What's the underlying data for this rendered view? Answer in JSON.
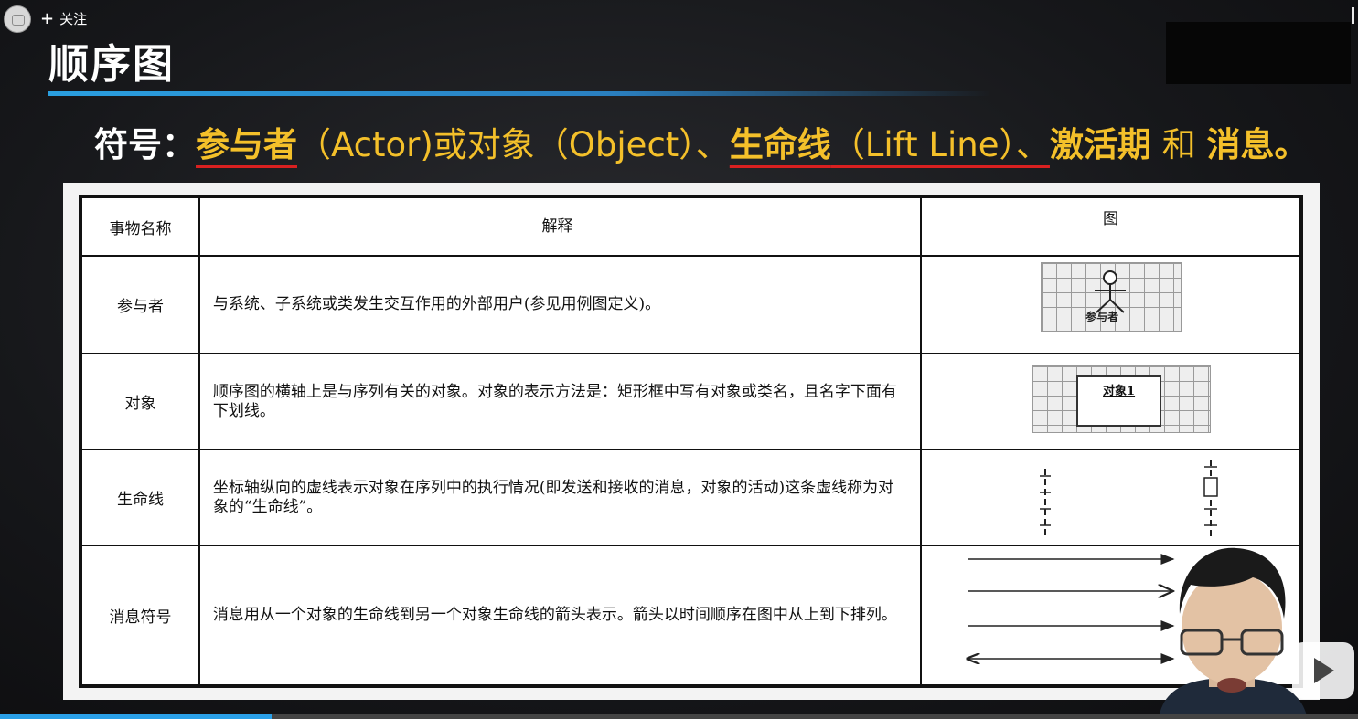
{
  "follow": {
    "label": "关注"
  },
  "slide": {
    "title": "顺序图",
    "subtitle_parts": [
      "符号：",
      "参与者",
      "（Actor)或对象（Object）、",
      "生命线",
      "（Lift Line）、",
      "激活期",
      " 和 ",
      "消息",
      "。"
    ]
  },
  "table": {
    "headers": [
      "事物名称",
      "解释",
      "图"
    ],
    "rows": [
      {
        "name": "参与者",
        "desc": "与系统、子系统或类发生交互作用的外部用户(参见用例图定义)。"
      },
      {
        "name": "对象",
        "desc": "顺序图的横轴上是与序列有关的对象。对象的表示方法是：矩形框中写有对象或类名，且名字下面有下划线。"
      },
      {
        "name": "生命线",
        "desc": "坐标轴纵向的虚线表示对象在序列中的执行情况(即发送和接收的消息，对象的活动)这条虚线称为对象的“生命线”。"
      },
      {
        "name": "消息符号",
        "desc": "消息用从一个对象的生命线到另一个对象生命线的箭头表示。箭头以时间顺序在图中从上到下排列。"
      }
    ],
    "figure_labels": {
      "actor": "参与者",
      "object": "对象1"
    }
  },
  "video": {
    "progress_fraction": 0.2
  },
  "colors": {
    "accent_yellow": "#f4c02a",
    "title_bar": "#2a9fe0",
    "underline_red": "#d92020"
  }
}
